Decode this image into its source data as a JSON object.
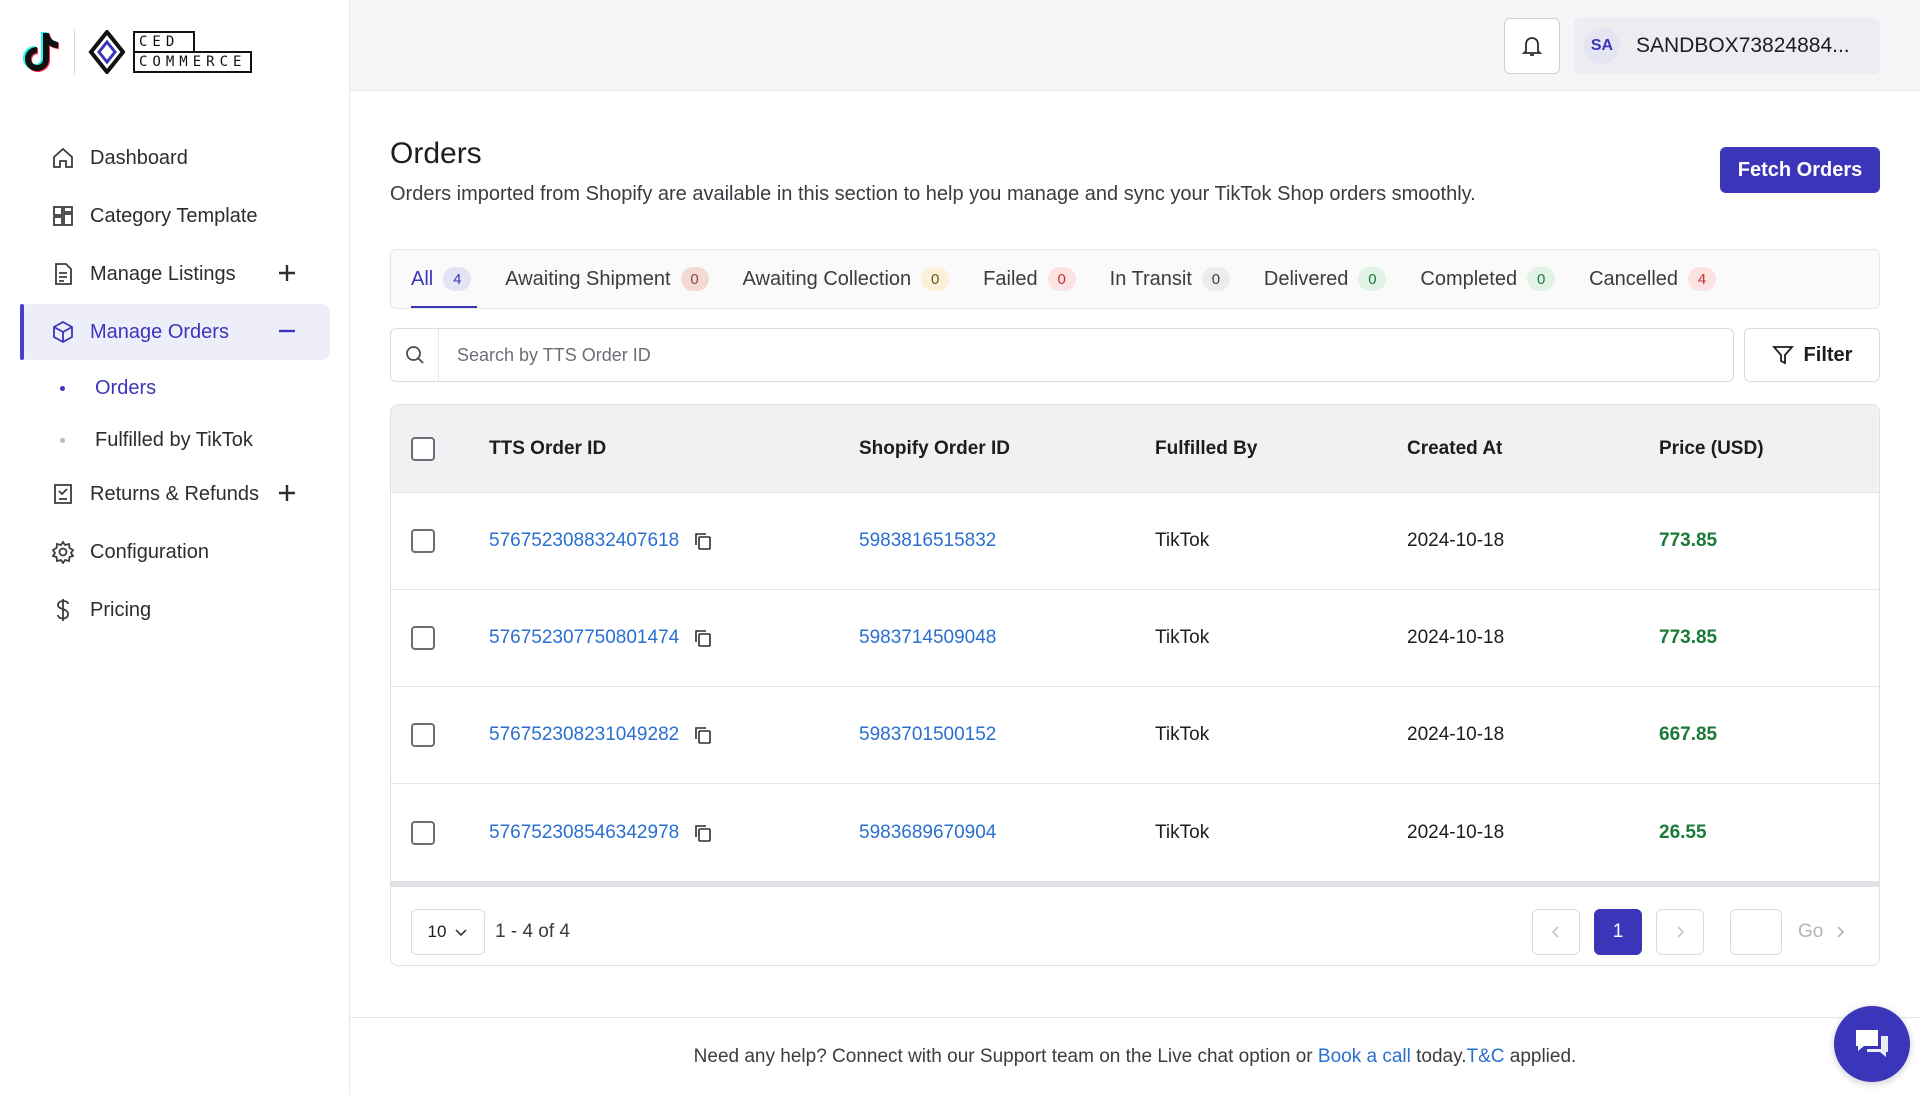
{
  "brand": {
    "ced_line1": "CED",
    "ced_line2": "COMMERCE",
    "accent": "#3b36b9"
  },
  "sidebar": {
    "items": [
      {
        "label": "Dashboard",
        "icon": "home-icon"
      },
      {
        "label": "Category Template",
        "icon": "grid-icon"
      },
      {
        "label": "Manage Listings",
        "icon": "document-icon",
        "expand": "+"
      },
      {
        "label": "Manage Orders",
        "icon": "box-icon",
        "expand": "−",
        "active": true
      },
      {
        "label": "Returns & Refunds",
        "icon": "return-icon",
        "expand": "+"
      },
      {
        "label": "Configuration",
        "icon": "gear-icon"
      },
      {
        "label": "Pricing",
        "icon": "dollar-icon"
      }
    ],
    "sub_items": [
      {
        "label": "Orders",
        "active": true
      },
      {
        "label": "Fulfilled by TikTok"
      }
    ]
  },
  "header": {
    "avatar_initials": "SA",
    "user_name": "SANDBOX73824884..."
  },
  "main": {
    "title": "Orders",
    "description": "Orders imported from Shopify are available in this section to help you manage and sync your TikTok Shop orders smoothly.",
    "fetch_label": "Fetch Orders",
    "tabs": [
      {
        "label": "All",
        "count": "4",
        "badge_bg": "#e4e4f6",
        "badge_fg": "#3b36b9"
      },
      {
        "label": "Awaiting Shipment",
        "count": "0",
        "badge_bg": "#f2d9d3",
        "badge_fg": "#8a4b3c"
      },
      {
        "label": "Awaiting Collection",
        "count": "0",
        "badge_bg": "#fbf1d8",
        "badge_fg": "#6b5417"
      },
      {
        "label": "Failed",
        "count": "0",
        "badge_bg": "#fbe3e3",
        "badge_fg": "#c0322b"
      },
      {
        "label": "In Transit",
        "count": "0",
        "badge_bg": "#ececef",
        "badge_fg": "#3a3c41"
      },
      {
        "label": "Delivered",
        "count": "0",
        "badge_bg": "#e0f3e6",
        "badge_fg": "#1a7a37"
      },
      {
        "label": "Completed",
        "count": "0",
        "badge_bg": "#e0f3e6",
        "badge_fg": "#1a7a37"
      },
      {
        "label": "Cancelled",
        "count": "4",
        "badge_bg": "#fbe3e3",
        "badge_fg": "#c0322b"
      }
    ],
    "search_placeholder": "Search by TTS Order ID",
    "filter_label": "Filter",
    "columns": [
      "TTS Order ID",
      "Shopify Order ID",
      "Fulfilled By",
      "Created At",
      "Price (USD)"
    ],
    "rows": [
      {
        "tts": "576752308832407618",
        "shopify": "5983816515832",
        "fulfilled": "TikTok",
        "created": "2024-10-18",
        "price": "773.85"
      },
      {
        "tts": "576752307750801474",
        "shopify": "5983714509048",
        "fulfilled": "TikTok",
        "created": "2024-10-18",
        "price": "773.85"
      },
      {
        "tts": "576752308231049282",
        "shopify": "5983701500152",
        "fulfilled": "TikTok",
        "created": "2024-10-18",
        "price": "667.85"
      },
      {
        "tts": "576752308546342978",
        "shopify": "5983689670904",
        "fulfilled": "TikTok",
        "created": "2024-10-18",
        "price": "26.55"
      }
    ],
    "pagination": {
      "per_page": "10",
      "range": "1 - 4 of 4",
      "current_page": "1",
      "go_label": "Go"
    }
  },
  "footer": {
    "text_before": "Need any help? Connect with our Support team on the Live chat option or ",
    "book_call": "Book a call",
    "text_middle": " today.",
    "tnc": "T&C",
    "text_after": " applied."
  }
}
